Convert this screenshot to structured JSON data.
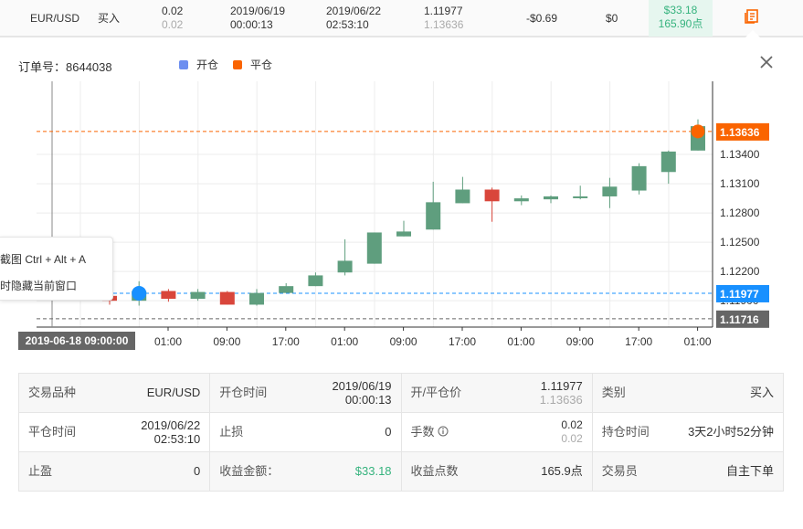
{
  "trade_row": {
    "symbol": "EUR/USD",
    "direction": "买入",
    "lots_open": "0.02",
    "lots_close": "0.02",
    "open_date": "2019/06/19",
    "open_time": "00:00:13",
    "close_date": "2019/06/22",
    "close_time": "02:53:10",
    "open_price": "1.11977",
    "close_price": "1.13636",
    "swap": "-$0.69",
    "commission": "$0",
    "profit": "$33.18",
    "points": "165.90点"
  },
  "panel": {
    "order_label": "订单号：8644038",
    "legend_open": "开仓",
    "legend_close": "平仓",
    "open_color": "#6d8ff0",
    "close_color": "#fa6400"
  },
  "tooltip": {
    "line1": "截图 Ctrl + Alt + A",
    "line2": "时隐藏当前窗口"
  },
  "chart_data": {
    "type": "candlestick",
    "x_ticks": [
      "01:00",
      "09:00",
      "17:00",
      "01:00",
      "09:00",
      "17:00",
      "01:00",
      "09:00",
      "17:00",
      "01:00"
    ],
    "y_ticks": [
      "1.13400",
      "1.13100",
      "1.12800",
      "1.12500",
      "1.12200",
      "1.11900"
    ],
    "ylim": [
      1.1163,
      1.1415
    ],
    "crosshair_label": "2019-06-18 09:00:00",
    "price_labels": [
      {
        "text": "1.13636",
        "value": 1.13636,
        "color": "#fa6400"
      },
      {
        "text": "1.11977",
        "value": 1.11977,
        "color": "#1890ff"
      },
      {
        "text": "1.11716",
        "value": 1.11716,
        "color": "#666666"
      }
    ],
    "candles": [
      {
        "o": 1.1195,
        "h": 1.1205,
        "l": 1.1186,
        "c": 1.119
      },
      {
        "o": 1.119,
        "h": 1.121,
        "l": 1.1185,
        "c": 1.12
      },
      {
        "o": 1.12,
        "h": 1.1202,
        "l": 1.1189,
        "c": 1.1192
      },
      {
        "o": 1.1192,
        "h": 1.1202,
        "l": 1.119,
        "c": 1.1199
      },
      {
        "o": 1.1199,
        "h": 1.12,
        "l": 1.1186,
        "c": 1.1186
      },
      {
        "o": 1.1186,
        "h": 1.1202,
        "l": 1.1185,
        "c": 1.1198
      },
      {
        "o": 1.1198,
        "h": 1.1208,
        "l": 1.1198,
        "c": 1.1205
      },
      {
        "o": 1.1205,
        "h": 1.1219,
        "l": 1.1205,
        "c": 1.1216
      },
      {
        "o": 1.1219,
        "h": 1.1253,
        "l": 1.1216,
        "c": 1.1231
      },
      {
        "o": 1.1228,
        "h": 1.126,
        "l": 1.1228,
        "c": 1.126
      },
      {
        "o": 1.1256,
        "h": 1.1272,
        "l": 1.1256,
        "c": 1.1261
      },
      {
        "o": 1.1263,
        "h": 1.1312,
        "l": 1.1263,
        "c": 1.1291
      },
      {
        "o": 1.129,
        "h": 1.1317,
        "l": 1.129,
        "c": 1.1304
      },
      {
        "o": 1.1304,
        "h": 1.1306,
        "l": 1.1271,
        "c": 1.1292
      },
      {
        "o": 1.1292,
        "h": 1.1298,
        "l": 1.1288,
        "c": 1.1295
      },
      {
        "o": 1.1294,
        "h": 1.1298,
        "l": 1.129,
        "c": 1.1297
      },
      {
        "o": 1.1296,
        "h": 1.1308,
        "l": 1.1294,
        "c": 1.1297
      },
      {
        "o": 1.1297,
        "h": 1.1316,
        "l": 1.1285,
        "c": 1.1307
      },
      {
        "o": 1.1303,
        "h": 1.1331,
        "l": 1.1299,
        "c": 1.1328
      },
      {
        "o": 1.1322,
        "h": 1.1344,
        "l": 1.131,
        "c": 1.1343
      },
      {
        "o": 1.1344,
        "h": 1.1376,
        "l": 1.1344,
        "c": 1.1369
      }
    ],
    "open_marker": {
      "index": 1,
      "value": 1.11977
    },
    "close_marker": {
      "index": 20,
      "value": 1.13636
    }
  },
  "info": {
    "r1": [
      {
        "label": "交易品种",
        "value": "EUR/USD"
      },
      {
        "label": "开仓时间",
        "value": "2019/06/19",
        "value2": "00:00:13"
      },
      {
        "label": "开/平仓价",
        "value": "1.11977",
        "value2": "1.13636"
      },
      {
        "label": "类别",
        "value": "买入"
      }
    ],
    "r2": [
      {
        "label": "平仓时间",
        "value": "2019/06/22",
        "value2": "02:53:10"
      },
      {
        "label": "止损",
        "value": "0"
      },
      {
        "label": "手数",
        "value": "0.02",
        "value2": "0.02"
      },
      {
        "label": "持仓时间",
        "value": "3天2小时52分钟"
      }
    ],
    "r3": [
      {
        "label": "止盈",
        "value": "0"
      },
      {
        "label": "收益金额：",
        "value": "$33.18"
      },
      {
        "label": "收益点数",
        "value": "165.9点"
      },
      {
        "label": "交易员",
        "value": "自主下单"
      }
    ]
  }
}
